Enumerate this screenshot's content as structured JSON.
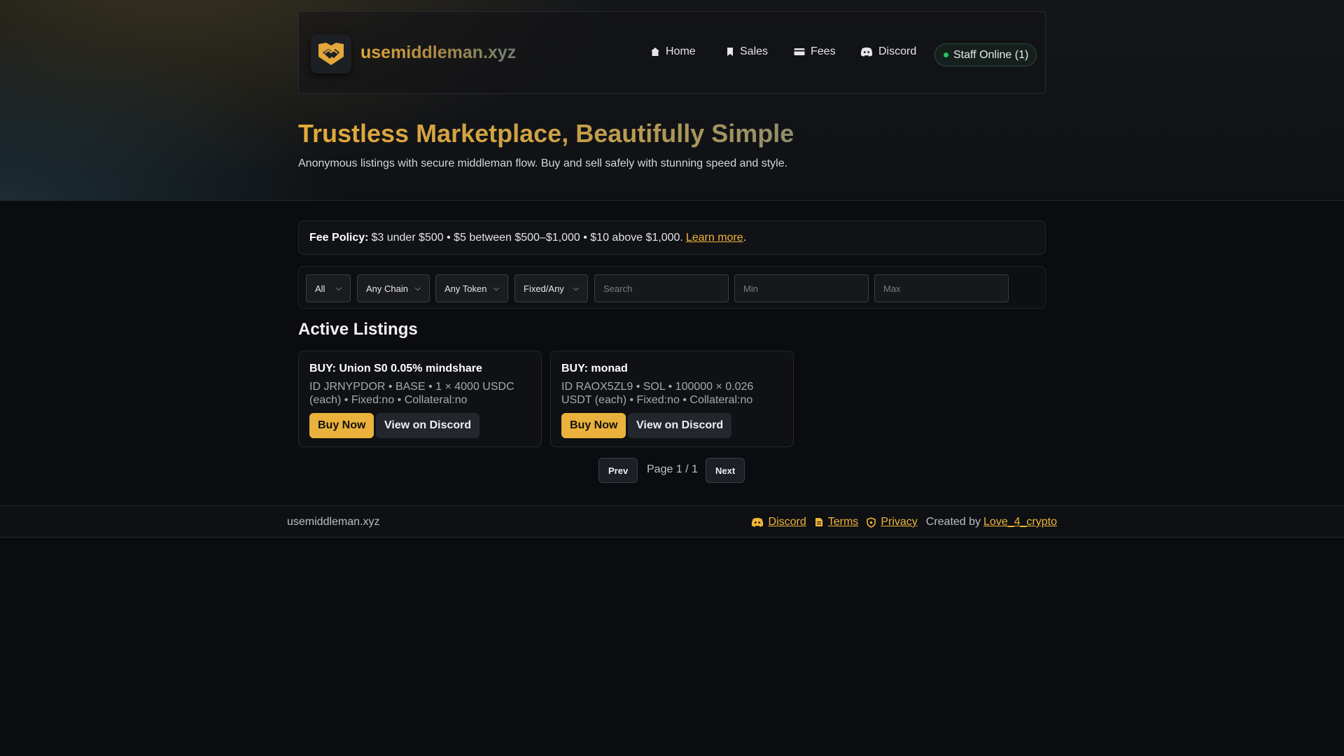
{
  "brand": {
    "name": "usemiddleman.xyz",
    "logo_icon": "handshake-icon",
    "accent": "#eab23c"
  },
  "nav": {
    "home": "Home",
    "sales": "Sales",
    "fees": "Fees",
    "discord": "Discord",
    "staff_status": "Staff Online (1)",
    "staff_status_color": "#22c55e"
  },
  "hero": {
    "title": "Trustless Marketplace, Beautifully Simple",
    "subtitle": "Anonymous listings with secure middleman flow. Buy and sell safely with stunning speed and style."
  },
  "fee_policy": {
    "label": "Fee Policy:",
    "text": "$3 under $500 • $5 between $500–$1,000 • $10 above $1,000.",
    "link": "Learn more",
    "end": "."
  },
  "filters": {
    "type": "All",
    "chain": "Any Chain",
    "token": "Any Token",
    "pricing": "Fixed/Any",
    "search_placeholder": "Search",
    "min_placeholder": "Min",
    "max_placeholder": "Max"
  },
  "listings": {
    "title": "Active Listings",
    "items": [
      {
        "title": "BUY: Union S0 0.05% mindshare",
        "meta": "ID JRNYPDOR • BASE • 1 × 4000 USDC (each) • Fixed:no • Collateral:no",
        "buy": "Buy Now",
        "discord": "View on Discord"
      },
      {
        "title": "BUY: monad",
        "meta": "ID RAOX5ZL9 • SOL • 100000 × 0.026 USDT (each) • Fixed:no • Collateral:no",
        "buy": "Buy Now",
        "discord": "View on Discord"
      }
    ]
  },
  "pagination": {
    "prev": "Prev",
    "page": "Page 1 / 1",
    "next": "Next"
  },
  "footer": {
    "brand": "usemiddleman.xyz",
    "discord": "Discord",
    "terms": "Terms",
    "privacy": "Privacy",
    "created_by": "Created by",
    "author": "Love_4_crypto"
  }
}
